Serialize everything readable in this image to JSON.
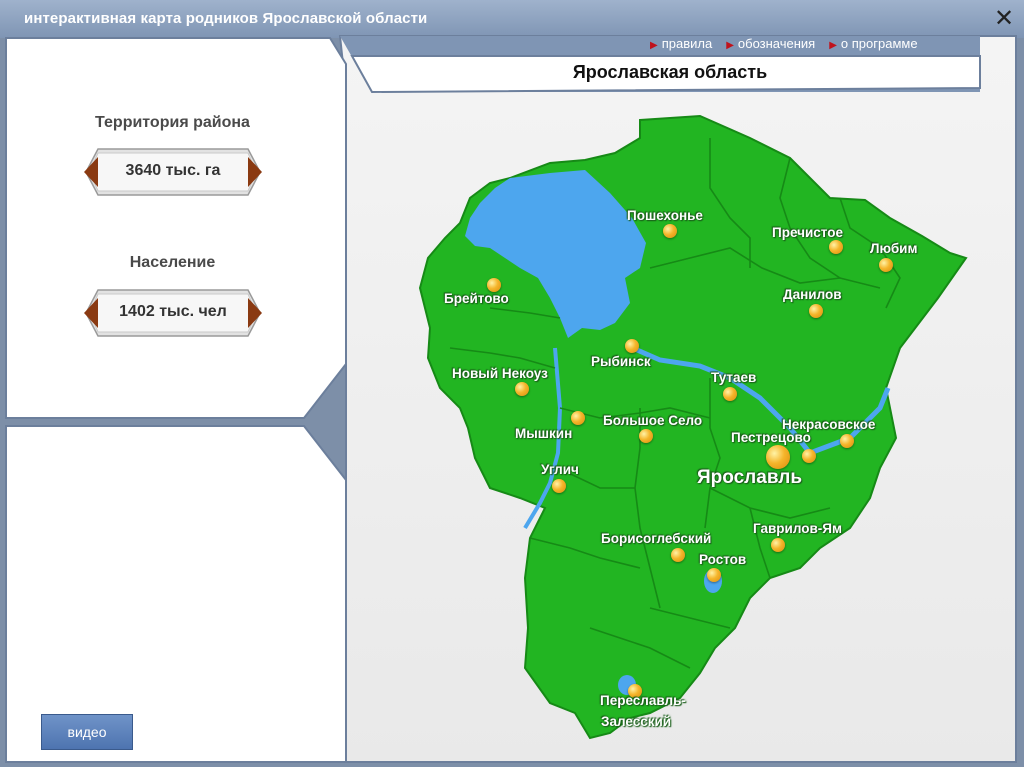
{
  "app": {
    "title": "интерактивная карта родников Ярославской области",
    "close_symbol": "✕"
  },
  "menu": [
    {
      "label": "правила",
      "icon": "arrow-right-icon"
    },
    {
      "label": "обозначения",
      "icon": "arrow-right-icon"
    },
    {
      "label": "о программе",
      "icon": "arrow-right-icon"
    }
  ],
  "region": {
    "title": "Ярославская область"
  },
  "stats": {
    "territory": {
      "label": "Территория района",
      "value": "3640 тыс. га"
    },
    "population": {
      "label": "Население",
      "value": "1402 тыс. чел"
    }
  },
  "video_button": {
    "label": "видео"
  },
  "map": {
    "land_color": "#22b522",
    "border_color": "#168a16",
    "water_color": "#4da6ee",
    "marker_color": "#f5b52b",
    "places": [
      {
        "name": "Пошехонье"
      },
      {
        "name": "Пречистое"
      },
      {
        "name": "Любим"
      },
      {
        "name": "Брейтово"
      },
      {
        "name": "Данилов"
      },
      {
        "name": "Рыбинск"
      },
      {
        "name": "Новый Некоуз"
      },
      {
        "name": "Тутаев"
      },
      {
        "name": "Мышкин"
      },
      {
        "name": "Большое Село"
      },
      {
        "name": "Некрасовское"
      },
      {
        "name": "Пестрецово"
      },
      {
        "name": "Ярославль"
      },
      {
        "name": "Углич"
      },
      {
        "name": "Гаврилов-Ям"
      },
      {
        "name": "Борисоглебский"
      },
      {
        "name": "Ростов"
      },
      {
        "name": "Переславль-"
      },
      {
        "name": "Залесский"
      }
    ]
  }
}
